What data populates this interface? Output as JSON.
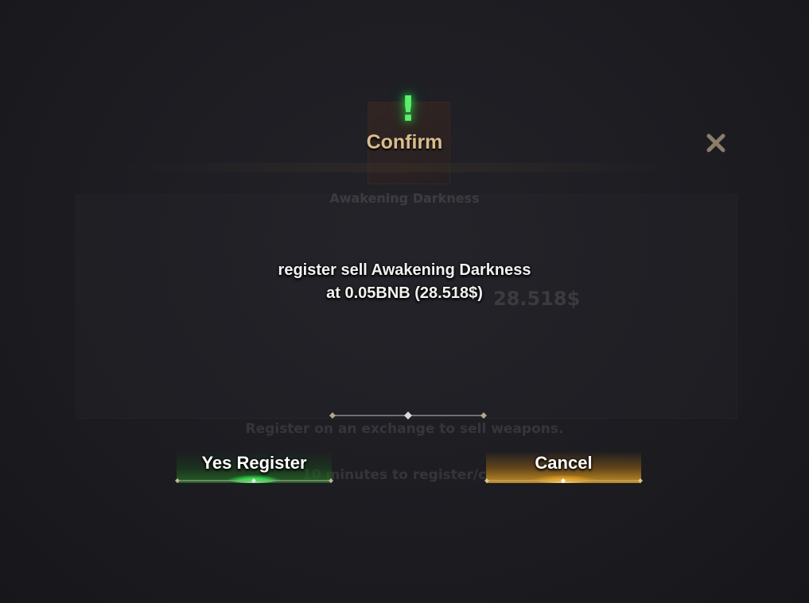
{
  "background": {
    "item_name": "Awakening Darkness",
    "price_hint": "28.518$",
    "register_hint": "Register on an exchange to sell weapons.",
    "time_hint": "10 minutes to register/c"
  },
  "dialog": {
    "icon": "exclamation-icon",
    "title": "Confirm",
    "message_line1": "register sell Awakening Darkness",
    "message_line2": "at 0.05BNB (28.518$)",
    "yes_label": "Yes Register",
    "cancel_label": "Cancel",
    "close_icon": "close-icon"
  },
  "colors": {
    "title": "#d8bd8c",
    "icon": "#5cf06a",
    "yes_button": "#2f8f35",
    "cancel_button": "#d99a20"
  }
}
